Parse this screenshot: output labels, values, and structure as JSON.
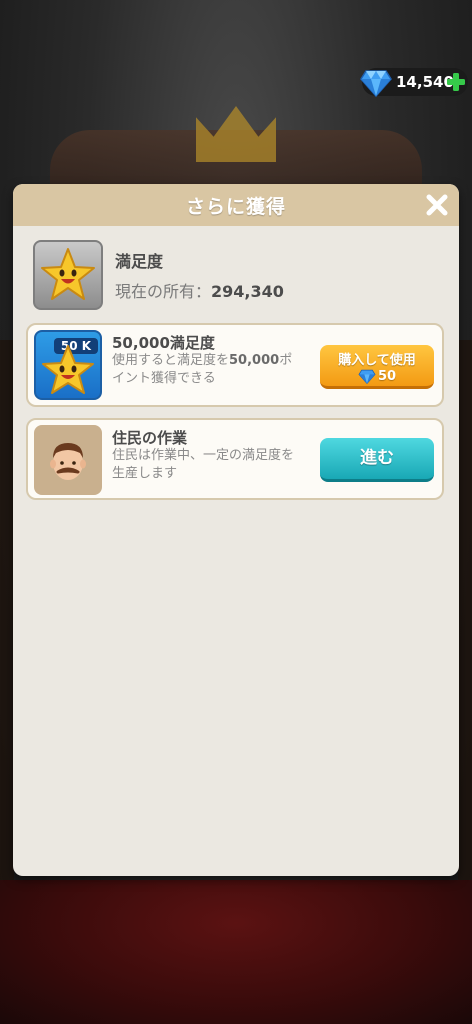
{
  "currency": {
    "icon": "diamond-icon",
    "amount": "14,540",
    "add_icon": "plus-icon"
  },
  "modal": {
    "title": "さらに獲得",
    "close_icon": "close-icon",
    "summary": {
      "icon": "star-face-icon",
      "title": "満足度",
      "owned_label": "現在の所有：",
      "owned_value": "294,340"
    },
    "items": [
      {
        "icon": "star-face-icon",
        "badge": "50 K",
        "title": "50,000満足度",
        "desc_line1_pre": "使用すると満足度を",
        "desc_line1_value": "50,000",
        "desc_line1_post": "ポ",
        "desc_line2": "イント獲得できる",
        "button_label": "購入して使用",
        "button_price": "50",
        "button_price_icon": "diamond-icon"
      },
      {
        "icon": "resident-avatar-icon",
        "title": "住民の作業",
        "desc_line1": "住民は作業中、一定の満足度を",
        "desc_line2": "生産します",
        "button_label": "進む"
      }
    ]
  },
  "colors": {
    "header": "#d9c6a3",
    "panel": "#ebe8e1",
    "buy_button": "#f7ad22",
    "go_button": "#2fc0cb",
    "star": "#f7c72b"
  }
}
